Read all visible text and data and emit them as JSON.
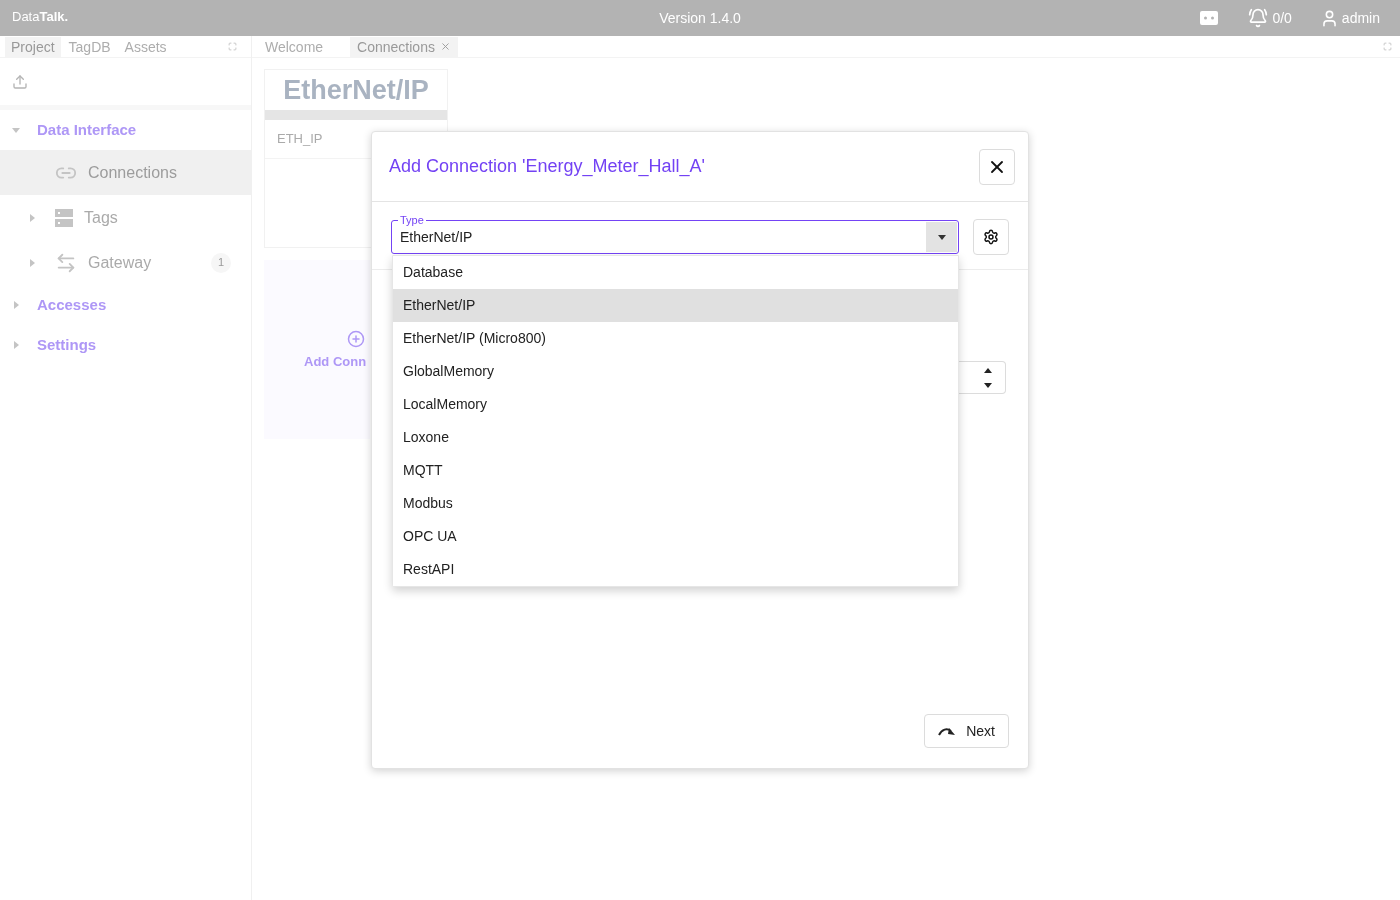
{
  "top_bar": {
    "logo": "Data**Talk.**",
    "version": "Version 1.4.0",
    "alarm_count": "0/0",
    "user": "admin"
  },
  "left_panel": {
    "tabs": [
      {
        "label": "Project",
        "selected": true
      },
      {
        "label": "TagDB",
        "selected": false
      },
      {
        "label": "Assets",
        "selected": false
      }
    ],
    "tree": [
      {
        "label": "Data Interface",
        "expanded": true,
        "children": [
          {
            "kind": "leaf",
            "label": "Connections",
            "selected": true
          },
          {
            "kind": "folder",
            "label": "Tags",
            "expanded": false,
            "selected": false
          },
          {
            "kind": "folder",
            "label": "Gateway",
            "expanded": false,
            "selected": false,
            "badge": "1"
          }
        ]
      },
      {
        "label": "Accesses",
        "expanded": false
      },
      {
        "label": "Settings",
        "expanded": false
      }
    ]
  },
  "editor": {
    "tabs": [
      {
        "label": "Welcome",
        "selected": false,
        "closable": false
      },
      {
        "label": "Connections",
        "selected": true,
        "closable": true
      }
    ],
    "connection_card": {
      "logo": "EtherNet/IP",
      "name": "ETH_IP"
    },
    "add_card": {
      "label": "Add Conn"
    }
  },
  "dialog": {
    "title": "Add Connection 'Energy_Meter_Hall_A'",
    "type_field": {
      "label": "Type",
      "value": "EtherNet/IP",
      "open": true,
      "options": [
        {
          "label": "Database",
          "selected": false
        },
        {
          "label": "EtherNet/IP",
          "selected": true
        },
        {
          "label": "EtherNet/IP (Micro800)",
          "selected": false
        },
        {
          "label": "GlobalMemory",
          "selected": false
        },
        {
          "label": "LocalMemory",
          "selected": false
        },
        {
          "label": "Loxone",
          "selected": false
        },
        {
          "label": "MQTT",
          "selected": false
        },
        {
          "label": "Modbus",
          "selected": false
        },
        {
          "label": "OPC UA",
          "selected": false
        },
        {
          "label": "RestAPI",
          "selected": false
        }
      ]
    },
    "next_button": "Next"
  }
}
